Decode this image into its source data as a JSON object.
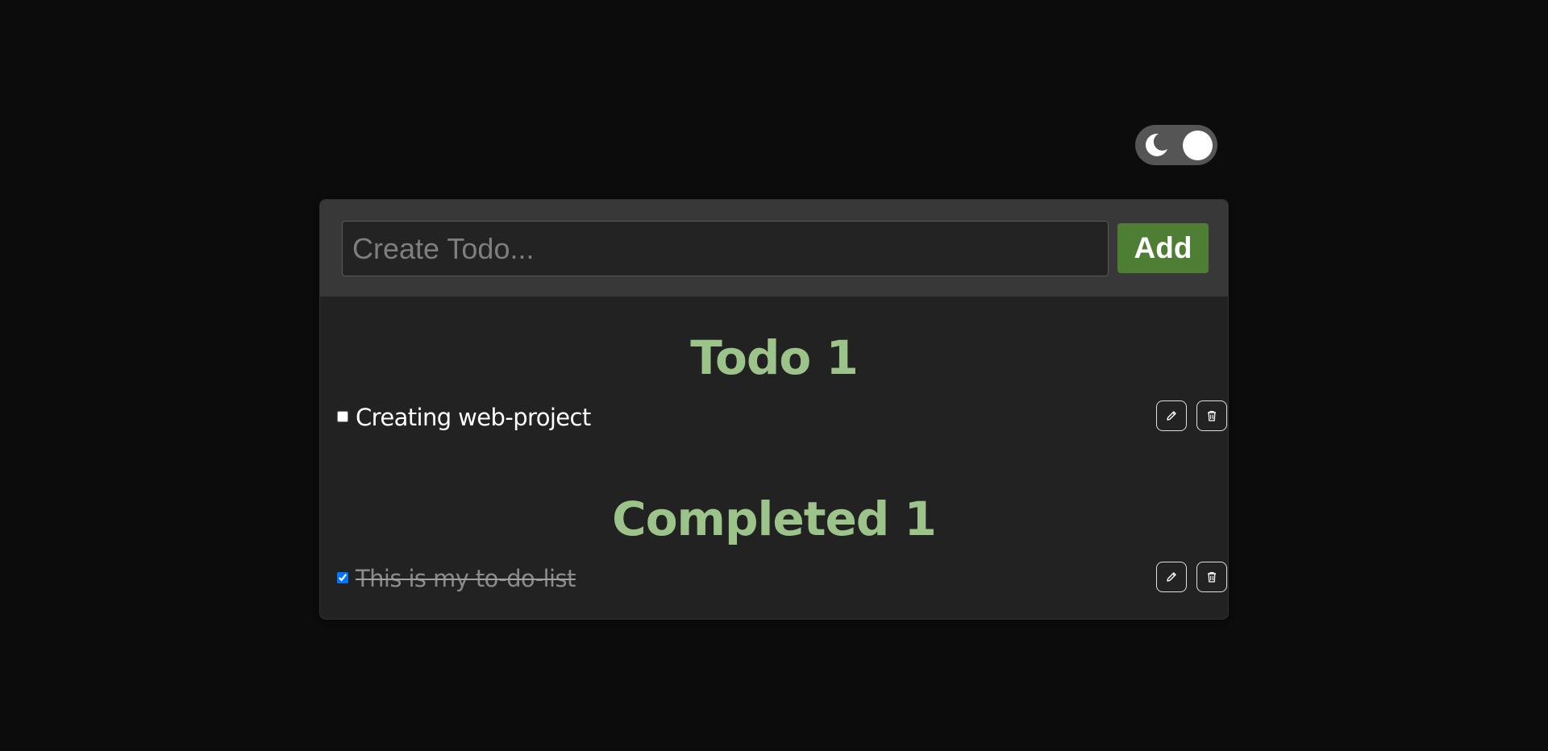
{
  "theme_toggle": {
    "icon": "moon-icon",
    "mode": "dark"
  },
  "form": {
    "input_placeholder": "Create Todo...",
    "input_value": "",
    "add_label": "Add"
  },
  "todo_section": {
    "title": "Todo 1",
    "items": [
      {
        "label": "Creating web-project",
        "checked": false
      }
    ]
  },
  "completed_section": {
    "title": "Completed 1",
    "items": [
      {
        "label": "This is my to-do-list",
        "checked": true
      }
    ]
  },
  "colors": {
    "background": "#0c0c0c",
    "card": "#222222",
    "header": "#383838",
    "accent_title": "#9cc48a",
    "add_button": "#4e7e34",
    "toggle_track": "#555555"
  },
  "icons": {
    "edit": "pencil-icon",
    "delete": "trash-icon"
  }
}
